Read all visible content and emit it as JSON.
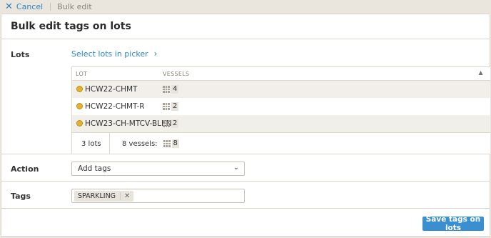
{
  "topbar": {
    "cancel_label": "Cancel",
    "crumb": "Bulk edit"
  },
  "page": {
    "title": "Bulk edit tags on lots"
  },
  "lots": {
    "label": "Lots",
    "picker_link": "Select lots in picker",
    "columns": [
      "LOT",
      "VESSELS"
    ],
    "rows": [
      {
        "name": "HCW22-CHMT",
        "vessels": "4"
      },
      {
        "name": "HCW22-CHMT-R",
        "vessels": "2"
      },
      {
        "name": "HCW23-CH-MTCV-BLEND",
        "vessels": "2"
      }
    ],
    "footer": {
      "lots_count": "3 lots",
      "vessels_label": "8 vessels:",
      "vessels_total": "8"
    }
  },
  "action": {
    "label": "Action",
    "selected": "Add tags"
  },
  "tags": {
    "label": "Tags",
    "items": [
      "SPARKLING"
    ]
  },
  "save_label": "Save tags on lots",
  "colors": {
    "accent": "#3a8fd0",
    "link": "#2a86c5",
    "lot_icon": "#e3b22e"
  },
  "icons": {
    "cancel": "close-icon",
    "picker": "chevron-right-icon",
    "sort": "caret-up-icon",
    "lot": "lot-status-icon",
    "vessels": "vessel-grid-icon",
    "select": "chevron-down-icon",
    "tag_remove": "close-icon"
  }
}
